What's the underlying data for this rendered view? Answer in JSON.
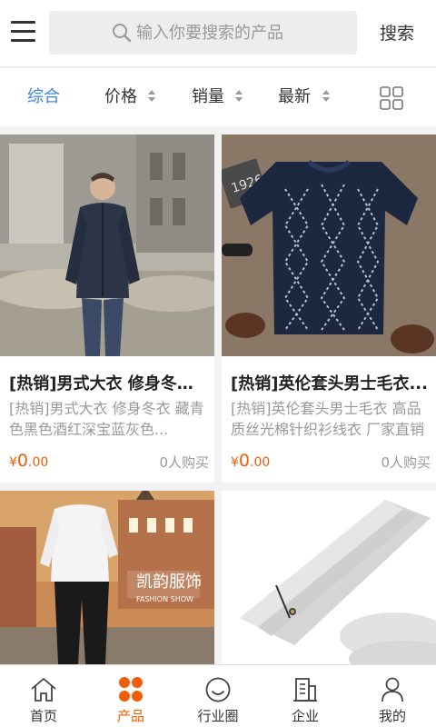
{
  "header": {
    "search_placeholder": "输入你要搜索的产品",
    "search_button": "搜索"
  },
  "sortbar": {
    "items": [
      {
        "label": "综合",
        "active": true
      },
      {
        "label": "价格",
        "active": false
      },
      {
        "label": "销量",
        "active": false
      },
      {
        "label": "最新",
        "active": false
      }
    ]
  },
  "products": [
    {
      "title": "[热销]男式大衣 修身冬季...",
      "description": "[热销]男式大衣 修身冬衣 藏青色黑色酒红深宝蓝灰色...",
      "currency": "¥",
      "price": "0",
      "price_decimal": ".00",
      "sold": "0人购买",
      "image": "man-navy-puffer-jacket-photo"
    },
    {
      "title": "[热销]英伦套头男士毛衣...",
      "description": "[热销]英伦套头男士毛衣 高品质丝光棉针织衫线衣 厂家直销",
      "currency": "¥",
      "price": "0",
      "price_decimal": ".00",
      "sold": "0人购买",
      "image": "navy-argyle-sweater-photo"
    },
    {
      "title": "",
      "description": "",
      "image": "man-white-shirt-black-trousers-photo",
      "banner_text": "凯韵服饰",
      "banner_sub": "FASHION SHOW"
    },
    {
      "title": "",
      "description": "",
      "image": "folded-grey-trousers-photo"
    }
  ],
  "bottom_nav": [
    {
      "label": "首页",
      "icon": "home-icon",
      "active": false
    },
    {
      "label": "产品",
      "icon": "products-icon",
      "active": true
    },
    {
      "label": "行业圈",
      "icon": "smile-icon",
      "active": false
    },
    {
      "label": "企业",
      "icon": "building-icon",
      "active": false
    },
    {
      "label": "我的",
      "icon": "user-icon",
      "active": false
    }
  ],
  "colors": {
    "accent_blue": "#3d86d6",
    "accent_orange": "#f25c05",
    "background": "#f2f2f2"
  }
}
